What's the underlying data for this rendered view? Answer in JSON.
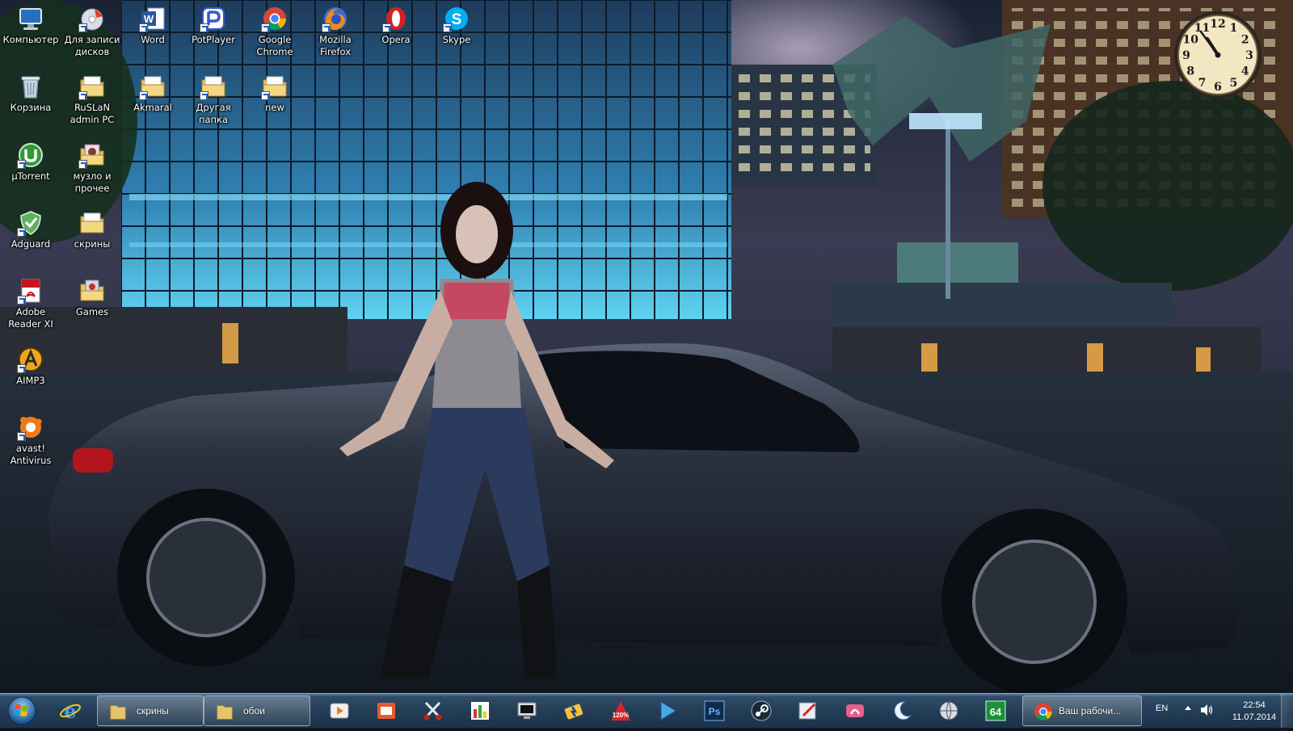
{
  "desktop": {
    "icons": [
      {
        "label": "Компьютер",
        "icon": "computer-icon"
      },
      {
        "label": "Для записи\nдисков",
        "icon": "burner-icon"
      },
      {
        "label": "Word",
        "icon": "word-icon"
      },
      {
        "label": "PotPlayer",
        "icon": "potplayer-icon"
      },
      {
        "label": "Google\nChrome",
        "icon": "chrome-icon"
      },
      {
        "label": "Mozilla\nFirefox",
        "icon": "firefox-icon"
      },
      {
        "label": "Opera",
        "icon": "opera-icon"
      },
      {
        "label": "Skype",
        "icon": "skype-icon"
      },
      {
        "label": "Корзина",
        "icon": "recycle-bin-icon"
      },
      {
        "label": "RuSLaN\nadmin PC",
        "icon": "folder-icon"
      },
      {
        "label": "Akmaral",
        "icon": "folder-icon"
      },
      {
        "label": "Другая\nпапка",
        "icon": "folder-icon"
      },
      {
        "label": "new",
        "icon": "folder-icon"
      },
      {
        "label": "µTorrent",
        "icon": "utorrent-icon"
      },
      {
        "label": "музло и\nпрочее",
        "icon": "music-folder-icon"
      },
      {
        "label": "Adguard",
        "icon": "adguard-icon"
      },
      {
        "label": "скрины",
        "icon": "folder-icon"
      },
      {
        "label": "Adobe\nReader XI",
        "icon": "adobe-reader-icon"
      },
      {
        "label": "Games",
        "icon": "games-folder-icon"
      },
      {
        "label": "AIMP3",
        "icon": "aimp-icon"
      },
      {
        "label": "avast!\nAntivirus",
        "icon": "avast-icon"
      }
    ]
  },
  "clock_gadget": {
    "numbers": [
      "12",
      "1",
      "2",
      "3",
      "4",
      "5",
      "6",
      "7",
      "8",
      "9",
      "10",
      "11"
    ],
    "hour": 10,
    "minute": 54
  },
  "taskbar": {
    "start": "windows-start-icon",
    "pinned_left": [
      {
        "icon": "internet-explorer-icon"
      }
    ],
    "open_windows": [
      {
        "label": "скрины",
        "icon": "folder-icon"
      },
      {
        "label": "обои",
        "icon": "folder-icon"
      }
    ],
    "pinned": [
      {
        "icon": "media-player-icon"
      },
      {
        "icon": "presentation-icon"
      },
      {
        "icon": "snipping-tool-icon"
      },
      {
        "icon": "chart-app-icon"
      },
      {
        "icon": "speed-monitor-icon"
      },
      {
        "icon": "flash-tool-icon"
      },
      {
        "icon": "zoom-120-icon",
        "text": "120%"
      },
      {
        "icon": "play-icon"
      },
      {
        "icon": "photoshop-icon",
        "text": "Ps"
      },
      {
        "icon": "steam-icon"
      },
      {
        "icon": "editor-icon"
      },
      {
        "icon": "pdf-tool-icon"
      },
      {
        "icon": "moon-app-icon"
      },
      {
        "icon": "globe-app-icon"
      },
      {
        "icon": "aida64-icon",
        "text": "64"
      }
    ],
    "active_window": {
      "label": "Ваш рабочи...",
      "icon": "chrome-icon"
    }
  },
  "tray": {
    "language": "EN",
    "time": "22:54",
    "date": "11.07.2014"
  }
}
